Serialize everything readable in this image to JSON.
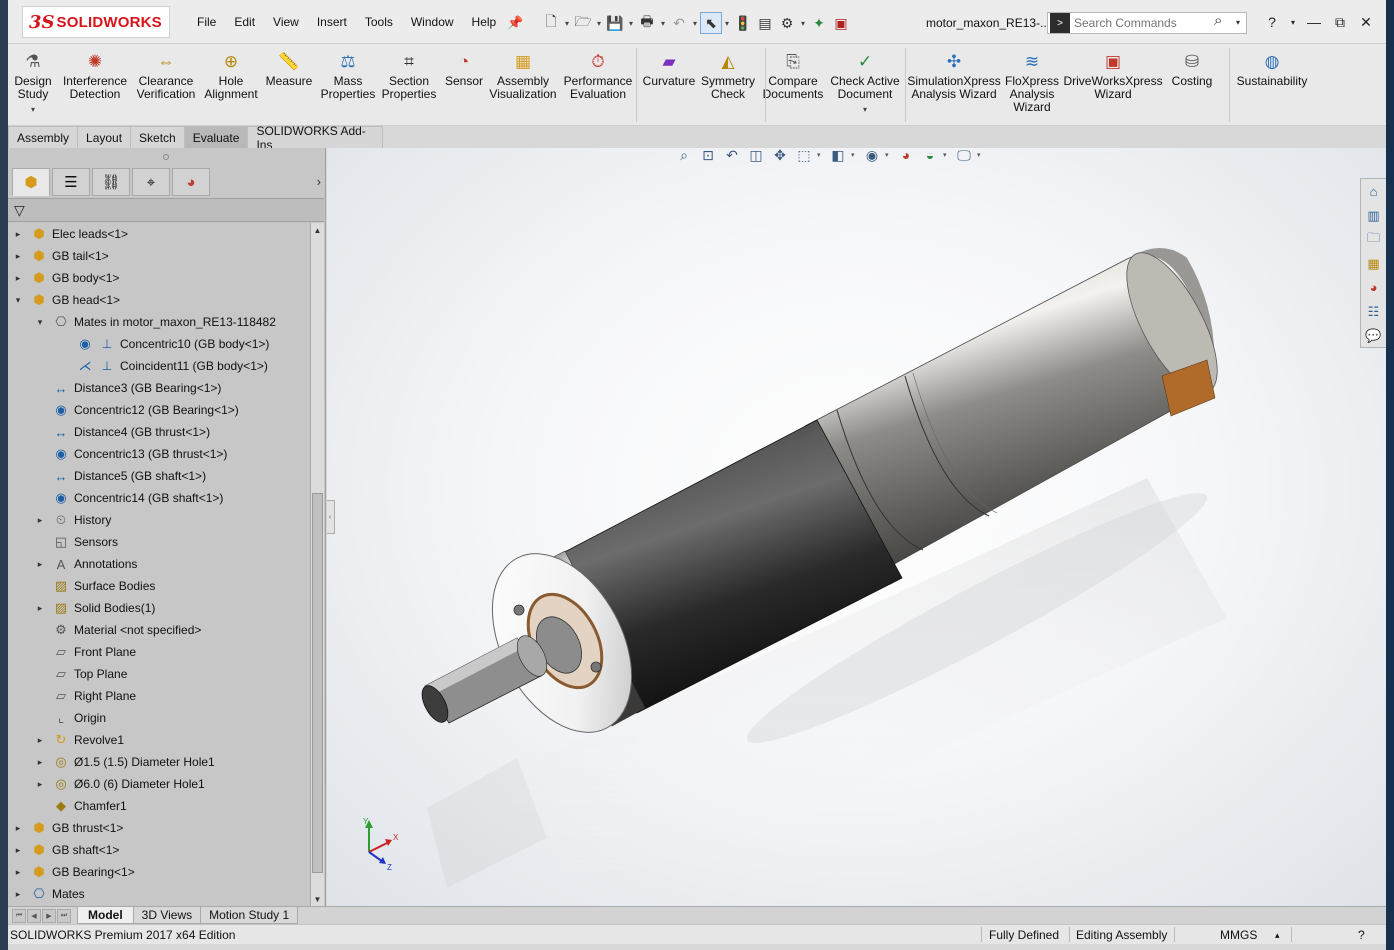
{
  "app": {
    "brand_mark": "3S",
    "brand": "SOLIDWORKS",
    "document_title": "motor_maxon_RE13-...",
    "menus": [
      "File",
      "Edit",
      "View",
      "Insert",
      "Tools",
      "Window",
      "Help"
    ]
  },
  "search": {
    "placeholder": "Search Commands",
    "prefix_icon": ">"
  },
  "window_controls": {
    "help": "?",
    "help_arrow": "▾",
    "minimize": "—",
    "restore": "⧉",
    "close": "✕"
  },
  "ribbon": {
    "buttons": [
      {
        "label": "Design\nStudy",
        "icon": "design-study-icon",
        "has_menu": true
      },
      {
        "label": "Interference\nDetection",
        "icon": "interference-icon"
      },
      {
        "label": "Clearance\nVerification",
        "icon": "clearance-icon"
      },
      {
        "label": "Hole\nAlignment",
        "icon": "hole-alignment-icon"
      },
      {
        "label": "Measure",
        "icon": "measure-icon"
      },
      {
        "label": "Mass\nProperties",
        "icon": "mass-properties-icon"
      },
      {
        "label": "Section\nProperties",
        "icon": "section-properties-icon"
      },
      {
        "label": "Sensor",
        "icon": "sensor-icon"
      },
      {
        "label": "Assembly\nVisualization",
        "icon": "assembly-visualization-icon"
      },
      {
        "label": "Performance\nEvaluation",
        "icon": "performance-icon"
      },
      {
        "label": "Curvature",
        "icon": "curvature-icon"
      },
      {
        "label": "Symmetry\nCheck",
        "icon": "symmetry-icon"
      },
      {
        "label": "Compare\nDocuments",
        "icon": "compare-icon"
      },
      {
        "label": "Check Active\nDocument",
        "icon": "check-document-icon",
        "has_menu": true
      },
      {
        "label": "SimulationXpress\nAnalysis Wizard",
        "icon": "simulation-icon"
      },
      {
        "label": "FloXpress\nAnalysis\nWizard",
        "icon": "floxpress-icon"
      },
      {
        "label": "DriveWorksXpress\nWizard",
        "icon": "driveworks-icon"
      },
      {
        "label": "Costing",
        "icon": "costing-icon"
      },
      {
        "label": "Sustainability",
        "icon": "sustainability-icon"
      }
    ],
    "menu_arrow": "▾"
  },
  "command_tabs": [
    {
      "label": "Assembly",
      "active": false
    },
    {
      "label": "Layout",
      "active": false
    },
    {
      "label": "Sketch",
      "active": false
    },
    {
      "label": "Evaluate",
      "active": true
    },
    {
      "label": "SOLIDWORKS Add-Ins",
      "active": false
    }
  ],
  "feature_manager": {
    "tabs": [
      "feature-manager-icon",
      "property-manager-icon",
      "configuration-manager-icon",
      "dimxpert-icon",
      "display-manager-icon"
    ],
    "more": "›",
    "filter_icon": "▽",
    "tree": [
      {
        "label": "Elec leads<1>",
        "icon": "part",
        "expand": "▸"
      },
      {
        "label": "GB tail<1>",
        "icon": "part",
        "expand": "▸"
      },
      {
        "label": "GB body<1>",
        "icon": "part",
        "expand": "▸"
      },
      {
        "label": "GB head<1>",
        "icon": "part",
        "expand": "▾"
      },
      {
        "label": "Mates in motor_maxon_RE13-118482",
        "icon": "mates-folder",
        "expand": "▾"
      },
      {
        "label": "Concentric10 (GB body<1>)",
        "icon": "concentric",
        "icon2": "fixed"
      },
      {
        "label": "Coincident11 (GB body<1>)",
        "icon": "coincident",
        "icon2": "fixed"
      },
      {
        "label": "Distance3 (GB Bearing<1>)",
        "icon": "distance"
      },
      {
        "label": "Concentric12 (GB Bearing<1>)",
        "icon": "concentric"
      },
      {
        "label": "Distance4 (GB thrust<1>)",
        "icon": "distance"
      },
      {
        "label": "Concentric13 (GB thrust<1>)",
        "icon": "concentric"
      },
      {
        "label": "Distance5 (GB shaft<1>)",
        "icon": "distance"
      },
      {
        "label": "Concentric14 (GB shaft<1>)",
        "icon": "concentric"
      },
      {
        "label": "History",
        "icon": "history",
        "expand": "▸"
      },
      {
        "label": "Sensors",
        "icon": "sensors"
      },
      {
        "label": "Annotations",
        "icon": "annotations",
        "expand": "▸"
      },
      {
        "label": "Surface Bodies",
        "icon": "surface-bodies"
      },
      {
        "label": "Solid Bodies(1)",
        "icon": "solid-bodies",
        "expand": "▸"
      },
      {
        "label": "Material <not specified>",
        "icon": "material"
      },
      {
        "label": "Front Plane",
        "icon": "plane"
      },
      {
        "label": "Top Plane",
        "icon": "plane"
      },
      {
        "label": "Right Plane",
        "icon": "plane"
      },
      {
        "label": "Origin",
        "icon": "origin"
      },
      {
        "label": "Revolve1",
        "icon": "revolve",
        "expand": "▸"
      },
      {
        "label": "Ø1.5 (1.5) Diameter Hole1",
        "icon": "hole",
        "expand": "▸"
      },
      {
        "label": "Ø6.0 (6) Diameter Hole1",
        "icon": "hole",
        "expand": "▸"
      },
      {
        "label": "Chamfer1",
        "icon": "chamfer"
      },
      {
        "label": "GB thrust<1>",
        "icon": "part",
        "expand": "▸"
      },
      {
        "label": "GB shaft<1>",
        "icon": "part",
        "expand": "▸"
      },
      {
        "label": "GB Bearing<1>",
        "icon": "part",
        "expand": "▸"
      },
      {
        "label": "Mates",
        "icon": "mates",
        "expand": "▸"
      }
    ]
  },
  "bottom_tabs": [
    {
      "label": "Model",
      "active": true
    },
    {
      "label": "3D Views",
      "active": false
    },
    {
      "label": "Motion Study 1",
      "active": false
    }
  ],
  "status": {
    "edition": "SOLIDWORKS Premium 2017 x64 Edition",
    "definition": "Fully Defined",
    "mode": "Editing Assembly",
    "units": "MMGS",
    "units_arrow": "▴",
    "help": "?"
  },
  "triad": {
    "x": "X",
    "y": "Y",
    "z": "Z"
  },
  "colors": {
    "brand": "#d7141a",
    "accent": "#2a6fb8"
  }
}
